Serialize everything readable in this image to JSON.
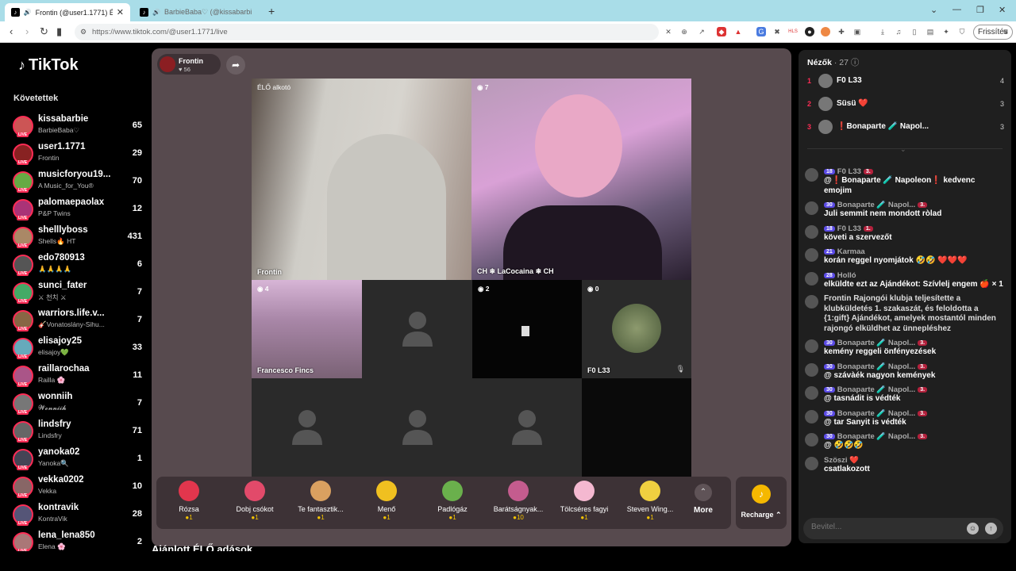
{
  "browser": {
    "tabs": [
      {
        "title": "Frontin (@user1.1771) ÉLŐ adás",
        "active": true
      },
      {
        "title": "BarbieBaba♡ (@kissabarbie) ÉLŐ",
        "active": false
      }
    ],
    "url": "https://www.tiktok.com/@user1.1771/live",
    "update_label": "Frissítés"
  },
  "sidebar": {
    "logo": "TikTok",
    "section_title": "Követettek",
    "following": [
      {
        "name": "kissabarbie",
        "sub": "BarbieBaba♡",
        "count": "65"
      },
      {
        "name": "user1.1771",
        "sub": "Frontin",
        "count": "29"
      },
      {
        "name": "musicforyou19...",
        "sub": "A Music_for_You®",
        "count": "70"
      },
      {
        "name": "palomaepaolax",
        "sub": "P&P Twins",
        "count": "12"
      },
      {
        "name": "shelllyboss",
        "sub": "Shells🔥 HT",
        "count": "431"
      },
      {
        "name": "edo780913",
        "sub": "🙏🙏🙏🙏",
        "count": "6"
      },
      {
        "name": "sunci_fater",
        "sub": "⚔ 천치 ⚔",
        "count": "7"
      },
      {
        "name": "warriors.life.v...",
        "sub": "🎸Vonatoslány-Sihu...",
        "count": "7"
      },
      {
        "name": "elisajoy25",
        "sub": "elisajoy💚",
        "count": "33"
      },
      {
        "name": "raillarochaa",
        "sub": "Railla 🌸",
        "count": "11"
      },
      {
        "name": "wonniih",
        "sub": "𝓦𝓸𝓷𝓷𝓲𝓲𝓱",
        "count": "7"
      },
      {
        "name": "lindsfry",
        "sub": "Lindsfry",
        "count": "71"
      },
      {
        "name": "yanoka02",
        "sub": "Yanoka🔍",
        "count": "1"
      },
      {
        "name": "vekka0202",
        "sub": "Vekka",
        "count": "10"
      },
      {
        "name": "kontravik",
        "sub": "KontraVik",
        "count": "28"
      },
      {
        "name": "lena_lena850",
        "sub": "Elena 🌸",
        "count": "2"
      }
    ]
  },
  "stream": {
    "host_name": "Frontin",
    "host_likes": "56",
    "tiles": {
      "main_tag": "ÉLŐ alkotó",
      "main_label": "Frontin",
      "guest1_badge": "7",
      "guest1_label": "LaCocaina",
      "guest2_badge": "4",
      "guest2_label": "Francesco Fincs",
      "guest3_badge": "2",
      "guest4_badge": "0",
      "guest4_label": "F0 L33"
    },
    "gifts": [
      {
        "name": "Rózsa",
        "price": "1"
      },
      {
        "name": "Dobj csókot",
        "price": "1"
      },
      {
        "name": "Te fantasztik...",
        "price": "1"
      },
      {
        "name": "Menő",
        "price": "1"
      },
      {
        "name": "Padlógáz",
        "price": "1"
      },
      {
        "name": "Barátságnyak...",
        "price": "10"
      },
      {
        "name": "Tölcséres fagyi",
        "price": "1"
      },
      {
        "name": "Steven Wing...",
        "price": "1"
      }
    ],
    "more_label": "More",
    "recharge_label": "Recharge"
  },
  "recommended_title": "Ajánlott ÉLŐ adások",
  "chat": {
    "viewers_label": "Nézők",
    "viewers_count": "· 27",
    "ranking": [
      {
        "rank": "1",
        "name": "F0 L33",
        "score": "4"
      },
      {
        "rank": "2",
        "name": "Süsü ❤️",
        "score": "3"
      },
      {
        "rank": "3",
        "name": "❗Bonaparte 🧪 Napol...",
        "score": "3"
      }
    ],
    "messages": [
      {
        "badge": "18",
        "user": "F0 L33",
        "level": "3.",
        "text": "@❗Bonaparte 🧪 Napoleon❗ kedvenc emojim"
      },
      {
        "badge": "30",
        "user": "Bonaparte 🧪 Napol...",
        "level": "3.",
        "text": "Juli semmit nem mondott ròlad"
      },
      {
        "badge": "18",
        "user": "F0 L33",
        "level": "1.",
        "text": "követi a szervezőt"
      },
      {
        "badge": "21",
        "user": "Karmaa",
        "level": "",
        "text": "korán reggel nyomjátok 🤣🤣 ❤️❤️❤️"
      },
      {
        "badge": "28",
        "user": "Holló",
        "level": "",
        "text": "elküldte ezt az Ajándékot: Szívlelj engem 🍎 × 1"
      },
      {
        "badge": "",
        "user": "",
        "level": "",
        "text": "Frontin Rajongói klubja teljesítette a klubküldetés 1. szakaszát, és feloldotta a {1:gift} Ajándékot, amelyek mostantól minden rajongó elküldhet az ünnepléshez"
      },
      {
        "badge": "30",
        "user": "Bonaparte 🧪 Napol...",
        "level": "3.",
        "text": "kemény reggeli önfényezések"
      },
      {
        "badge": "30",
        "user": "Bonaparte 🧪 Napol...",
        "level": "3.",
        "text": "@ szávàék nagyon kemények"
      },
      {
        "badge": "30",
        "user": "Bonaparte 🧪 Napol...",
        "level": "3.",
        "text": "@ tasnádit is védték"
      },
      {
        "badge": "30",
        "user": "Bonaparte 🧪 Napol...",
        "level": "3.",
        "text": "@ tar Sanyit is védték"
      },
      {
        "badge": "30",
        "user": "Bonaparte 🧪 Napol...",
        "level": "3.",
        "text": "@ 🤣🤣🤣"
      },
      {
        "badge": "",
        "user": "Szöszi ❤️",
        "level": "",
        "text": "csatlakozott"
      }
    ],
    "input_placeholder": "Beviteĺ..."
  },
  "colors": {
    "accent": "#fe2c55",
    "stage_bg": "#574a4e",
    "coin": "#f5c400"
  }
}
